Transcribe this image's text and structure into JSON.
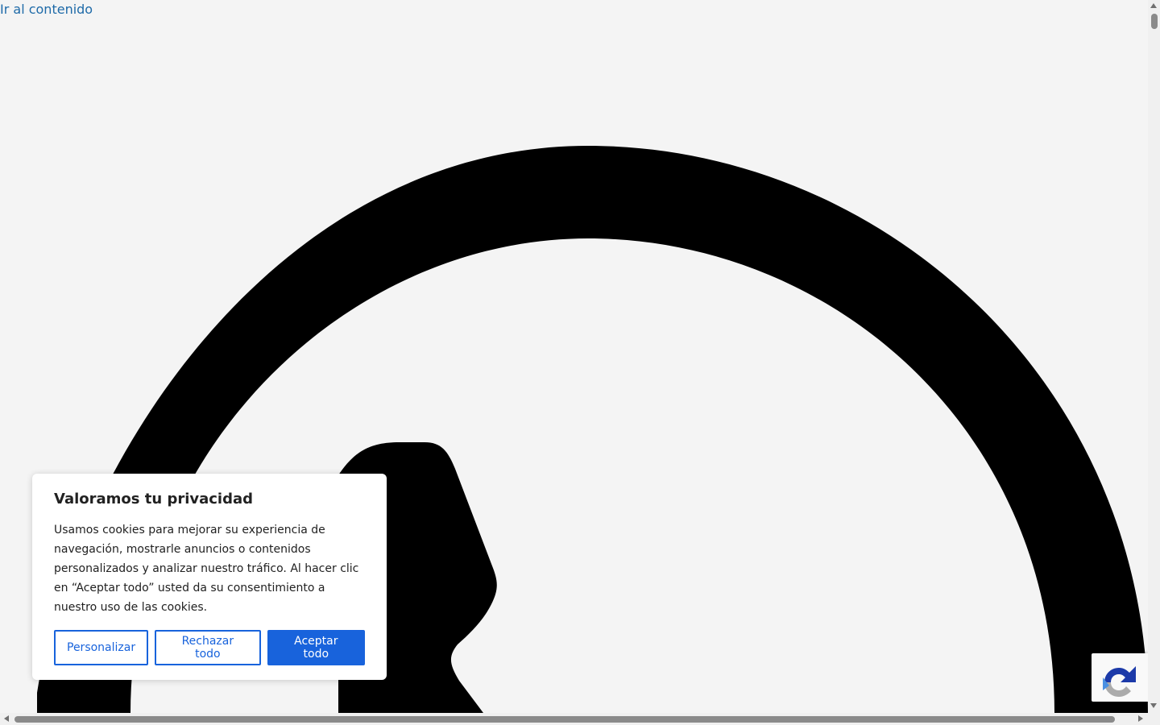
{
  "skip_link": {
    "label": "Ir al contenido"
  },
  "logo": {
    "icon": "whatsapp-logo-icon",
    "color": "#000000"
  },
  "cookie_banner": {
    "title": "Valoramos tu privacidad",
    "text": "Usamos cookies para mejorar su experiencia de navegación, mostrarle anuncios o contenidos personalizados y analizar nuestro tráfico. Al hacer clic en “Aceptar todo” usted da su consentimiento a nuestro uso de las cookies.",
    "buttons": {
      "customize": "Personalizar",
      "reject": "Rechazar todo",
      "accept": "Aceptar todo"
    },
    "accent_color": "#1863dc"
  },
  "recaptcha": {
    "icon": "recaptcha-icon"
  }
}
